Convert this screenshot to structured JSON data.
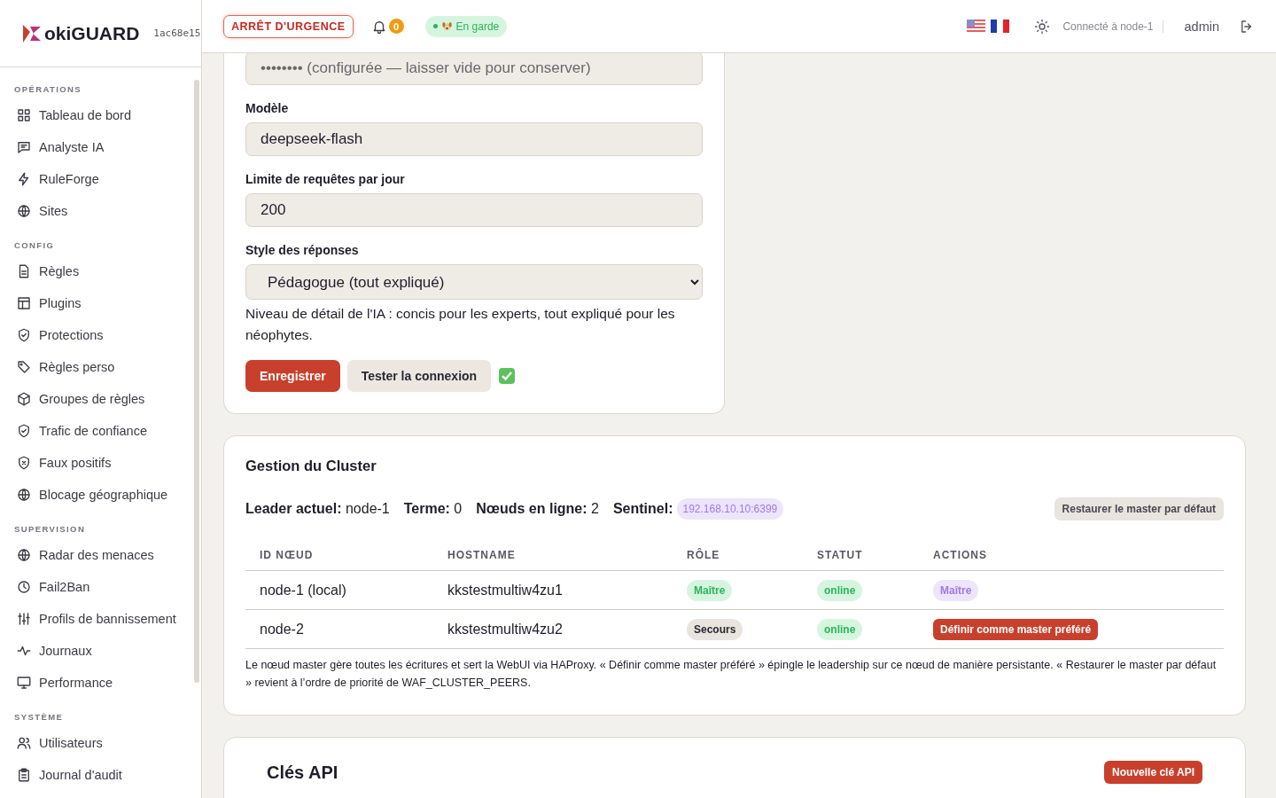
{
  "brand": {
    "name": "okiGUARD",
    "version": "1ac68e15"
  },
  "sidebar": {
    "sections": [
      {
        "title": "OPÉRATIONS",
        "items": [
          {
            "label": "Tableau de bord"
          },
          {
            "label": "Analyste IA"
          },
          {
            "label": "RuleForge"
          },
          {
            "label": "Sites"
          }
        ]
      },
      {
        "title": "CONFIG",
        "items": [
          {
            "label": "Règles"
          },
          {
            "label": "Plugins"
          },
          {
            "label": "Protections"
          },
          {
            "label": "Règles perso"
          },
          {
            "label": "Groupes de règles"
          },
          {
            "label": "Trafic de confiance"
          },
          {
            "label": "Faux positifs"
          },
          {
            "label": "Blocage géographique"
          }
        ]
      },
      {
        "title": "SUPERVISION",
        "items": [
          {
            "label": "Radar des menaces"
          },
          {
            "label": "Fail2Ban"
          },
          {
            "label": "Profils de bannissement"
          },
          {
            "label": "Journaux"
          },
          {
            "label": "Performance"
          }
        ]
      },
      {
        "title": "SYSTÈME",
        "items": [
          {
            "label": "Utilisateurs"
          },
          {
            "label": "Journal d'audit"
          }
        ]
      }
    ]
  },
  "header": {
    "emergency_button": "ARRÊT D'URGENCE",
    "notification_count": "0",
    "status": "En garde",
    "connection": "Connecté à node-1",
    "user": "admin"
  },
  "ai_settings": {
    "key_field": {
      "placeholder": "•••••••• (configurée — laisser vide pour conserver)"
    },
    "fields": [
      {
        "label": "Modèle",
        "value": "deepseek-flash"
      },
      {
        "label": "Limite de requêtes par jour",
        "value": "200"
      }
    ],
    "style": {
      "label": "Style des réponses",
      "value": "Pédagogue (tout expliqué)",
      "help": "Niveau de détail de l'IA : concis pour les experts, tout expliqué pour les néophytes."
    },
    "buttons": [
      "Enregistrer",
      "Tester la connexion"
    ],
    "test_ok": true
  },
  "cluster": {
    "title": "Gestion du Cluster",
    "stats": [
      "**Leader actuel:** node-1",
      "**Terme:** 0",
      "**Nœuds en ligne:** 2"
    ],
    "sentinel_label": "Sentinel:",
    "sentinel": "192.168.10.10:6399",
    "restore_button": "Restaurer le master par défaut",
    "columns": [
      "ID NŒUD",
      "HOSTNAME",
      "RÔLE",
      "STATUT",
      "ACTIONS"
    ],
    "rows": [
      {
        "id": "node-1 (local)",
        "hostname": "kkstestmultiw4zu1",
        "role": {
          "kind": "master",
          "text": "Maître"
        },
        "status": "online",
        "action": {
          "kind": "badge",
          "text": "Maître"
        }
      },
      {
        "id": "node-2",
        "hostname": "kkstestmultiw4zu2",
        "role": {
          "kind": "backup",
          "text": "Secours"
        },
        "status": "online",
        "action": {
          "kind": "button",
          "text": "Définir comme master préféré"
        }
      }
    ],
    "note": "Le nœud master gère toutes les écritures et sert la WebUI via HAProxy. « Définir comme master préféré » épingle le leadership sur ce nœud de manière persistante. « Restaurer le master par défaut » revient à l’ordre de priorité de WAF_CLUSTER_PEERS."
  },
  "api_keys": {
    "title": "Clés API",
    "new_button": "Nouvelle clé API"
  }
}
